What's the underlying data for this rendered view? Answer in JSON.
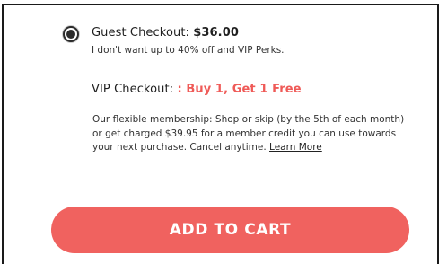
{
  "guest": {
    "label": "Guest Checkout: ",
    "price": "$36.00",
    "subtitle": "I don't want up to 40% off and VIP Perks.",
    "selected": true
  },
  "vip": {
    "label": "VIP Checkout: ",
    "promo": ": Buy 1, Get 1 Free",
    "selected": false,
    "description": "Our flexible membership: Shop or skip (by the 5th of each month) or get charged $39.95 for a member credit you can use towards your next purchase. Cancel anytime. ",
    "learn_more": "Learn More"
  },
  "cart": {
    "button_label": "ADD TO CART"
  },
  "colors": {
    "accent": "#f0625f",
    "promo_text": "#ef5a57"
  }
}
